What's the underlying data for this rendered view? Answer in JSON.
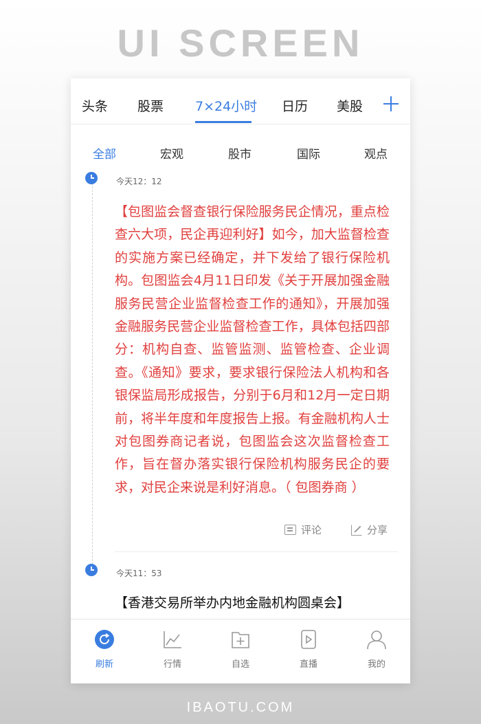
{
  "header": {
    "title": "UI SCREEN"
  },
  "top_tabs": [
    {
      "label": "头条",
      "active": false
    },
    {
      "label": "股票",
      "active": false
    },
    {
      "label": "7×24小时",
      "active": true
    },
    {
      "label": "日历",
      "active": false
    },
    {
      "label": "美股",
      "active": false
    }
  ],
  "sub_tabs": [
    {
      "label": "全部",
      "active": true
    },
    {
      "label": "宏观",
      "active": false
    },
    {
      "label": "股市",
      "active": false
    },
    {
      "label": "国际",
      "active": false
    },
    {
      "label": "观点",
      "active": false
    }
  ],
  "news": [
    {
      "time": "今天12：12",
      "body": "【包图监会督查银行保险服务民企情况，重点检查六大项，民企再迎利好】如今，加大监督检查的实施方案已经确定，并下发给了银行保险机构。包图监会4月11日印发《关于开展加强金融服务民营企业监督检查工作的通知》，开展加强金融服务民营企业监督检查工作，具体包括四部分：机构自查、监管监测、监管检查、企业调查。《通知》要求，要求银行保险法人机构和各银保监局形成报告，分别于6月和12月一定日期前，将半年度和年度报告上报。有金融机构人士对包图券商记者说，包图监会这次监督检查工作，旨在督办落实银行保险机构服务民企的要求，对民企来说是利好消息。（ 包图券商 ）",
      "comment_label": "评论",
      "share_label": "分享"
    },
    {
      "time": "今天11：53",
      "title": "【香港交易所举办内地金融机构圆桌会】"
    }
  ],
  "bottom_nav": [
    {
      "label": "刷新",
      "icon": "refresh-icon",
      "active": true
    },
    {
      "label": "行情",
      "icon": "chart-icon",
      "active": false
    },
    {
      "label": "自选",
      "icon": "folder-add-icon",
      "active": false
    },
    {
      "label": "直播",
      "icon": "play-icon",
      "active": false
    },
    {
      "label": "我的",
      "icon": "user-icon",
      "active": false
    }
  ],
  "footer": {
    "watermark": "IBAOTU.COM"
  },
  "colors": {
    "accent": "#3a7de0",
    "news_red": "#e0403e"
  }
}
